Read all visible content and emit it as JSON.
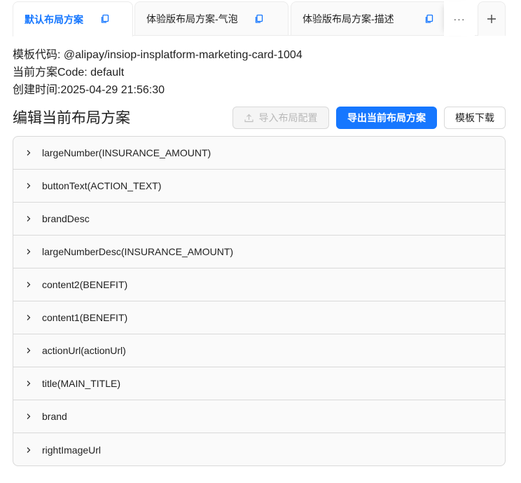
{
  "tabs": [
    {
      "label": "默认布局方案",
      "active": true
    },
    {
      "label": "体验版布局方案-气泡",
      "active": false
    },
    {
      "label": "体验版布局方案-描述",
      "active": false
    }
  ],
  "tab_more_label": "···",
  "info": {
    "template_code": "模板代码: @alipay/insiop-insplatform-marketing-card-1004",
    "scheme_code": "当前方案Code: default",
    "created_time": "创建时间:2025-04-29 21:56:30"
  },
  "section_title": "编辑当前布局方案",
  "buttons": {
    "import": "导入布局配置",
    "export": "导出当前布局方案",
    "download": "模板下载"
  },
  "panels": [
    "largeNumber(INSURANCE_AMOUNT)",
    "buttonText(ACTION_TEXT)",
    "brandDesc",
    "largeNumberDesc(INSURANCE_AMOUNT)",
    "content2(BENEFIT)",
    "content1(BENEFIT)",
    "actionUrl(actionUrl)",
    "title(MAIN_TITLE)",
    "brand",
    "rightImageUrl"
  ],
  "colors": {
    "primary": "#1677ff",
    "border": "#d9d9d9",
    "panel_bg": "#fafafa"
  }
}
